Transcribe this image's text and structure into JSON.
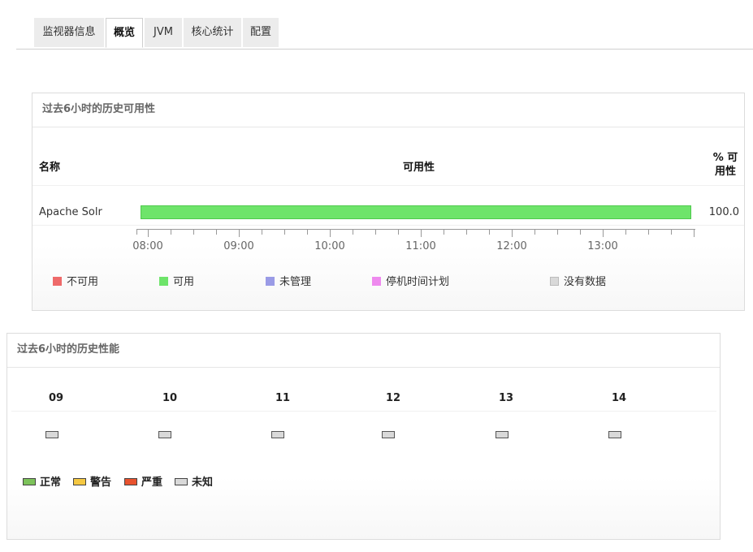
{
  "tabs": [
    {
      "label": "监视器信息",
      "active": false
    },
    {
      "label": "概览",
      "active": true
    },
    {
      "label": "JVM",
      "active": false
    },
    {
      "label": "核心统计",
      "active": false
    },
    {
      "label": "配置",
      "active": false
    }
  ],
  "availability": {
    "title": "过去6小时的历史可用性",
    "col_name": "名称",
    "col_availability": "可用性",
    "col_percent_line1": "% 可",
    "col_percent_line2": "用性",
    "rows": [
      {
        "name": "Apache Solr",
        "percent": "100.0",
        "status": "available",
        "fraction": 1.0
      }
    ],
    "ticks": [
      "08:00",
      "09:00",
      "10:00",
      "11:00",
      "12:00",
      "13:00"
    ],
    "legend": [
      {
        "label": "不可用",
        "color": "#ee6a6a"
      },
      {
        "label": "可用",
        "color": "#6ee46a"
      },
      {
        "label": "未管理",
        "color": "#9a9be6"
      },
      {
        "label": "停机时间计划",
        "color": "#ee8aee"
      },
      {
        "label": "没有数据",
        "color": "#d9d9d9"
      }
    ]
  },
  "performance": {
    "title": "过去6小时的历史性能",
    "hours": [
      "09",
      "10",
      "11",
      "12",
      "13",
      "14"
    ],
    "hour_status": [
      "unknown",
      "unknown",
      "unknown",
      "unknown",
      "unknown",
      "unknown"
    ],
    "legend": [
      {
        "label": "正常",
        "color": "#7cc25a"
      },
      {
        "label": "警告",
        "color": "#f5c842"
      },
      {
        "label": "严重",
        "color": "#e8522e"
      },
      {
        "label": "未知",
        "color": "#d9d9d9"
      }
    ]
  }
}
